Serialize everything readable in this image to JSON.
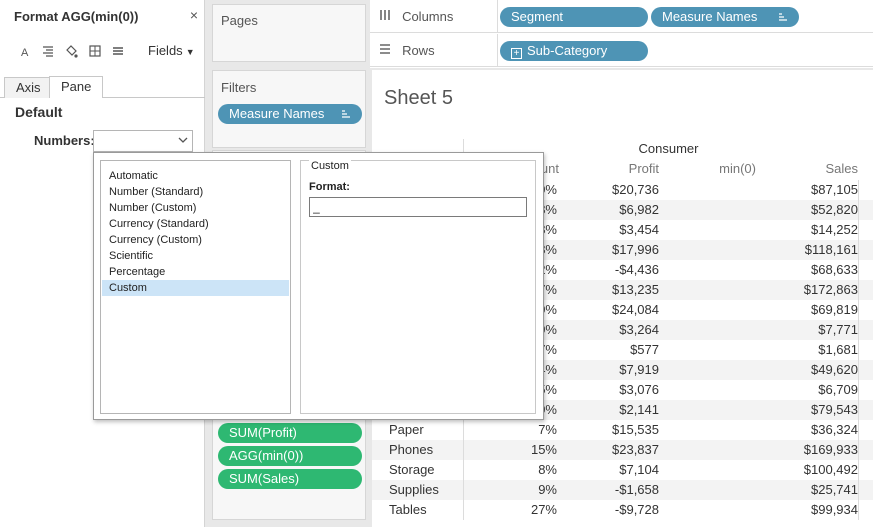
{
  "format_pane": {
    "title": "Format AGG(min(0))",
    "close": "×",
    "fields_label": "Fields",
    "tabs": [
      "Axis",
      "Pane"
    ],
    "active_tab": "Pane",
    "section": "Default",
    "numbers_label": "Numbers:",
    "numbers_value": "",
    "icons": [
      "font-icon",
      "alignment-icon",
      "shading-icon",
      "borders-icon",
      "lines-icon"
    ]
  },
  "cards": {
    "pages": "Pages",
    "filters": "Filters",
    "filter_pills": [
      "Measure Names"
    ],
    "marks_pills": [
      "SUM(Profit)",
      "AGG(min(0))",
      "SUM(Sales)"
    ]
  },
  "shelves": {
    "columns_label": "Columns",
    "rows_label": "Rows",
    "columns_pills": [
      "Segment",
      "Measure Names"
    ],
    "rows_pills": [
      "Sub-Category"
    ]
  },
  "view": {
    "sheet_title": "Sheet 5",
    "segment_header": "Consumer",
    "column_headers": [
      "unt",
      "Profit",
      "min(0)",
      "Sales"
    ],
    "rows": [
      {
        "subcat": "",
        "count": "9%",
        "profit": "$20,736",
        "sales": "$87,105"
      },
      {
        "subcat": "",
        "count": "8%",
        "profit": "$6,982",
        "sales": "$52,820"
      },
      {
        "subcat": "",
        "count": "8%",
        "profit": "$3,454",
        "sales": "$14,252"
      },
      {
        "subcat": "",
        "count": "8%",
        "profit": "$17,996",
        "sales": "$118,161"
      },
      {
        "subcat": "",
        "count": "2%",
        "profit": "-$4,436",
        "sales": "$68,633"
      },
      {
        "subcat": "",
        "count": "7%",
        "profit": "$13,235",
        "sales": "$172,863"
      },
      {
        "subcat": "",
        "count": "9%",
        "profit": "$24,084",
        "sales": "$69,819"
      },
      {
        "subcat": "",
        "count": "9%",
        "profit": "$3,264",
        "sales": "$7,771"
      },
      {
        "subcat": "",
        "count": "7%",
        "profit": "$577",
        "sales": "$1,681"
      },
      {
        "subcat": "",
        "count": "4%",
        "profit": "$7,919",
        "sales": "$49,620"
      },
      {
        "subcat": "",
        "count": "5%",
        "profit": "$3,076",
        "sales": "$6,709"
      },
      {
        "subcat": "",
        "count": "9%",
        "profit": "$2,141",
        "sales": "$79,543"
      },
      {
        "subcat": "Paper",
        "count": "7%",
        "profit": "$15,535",
        "sales": "$36,324"
      },
      {
        "subcat": "Phones",
        "count": "15%",
        "profit": "$23,837",
        "sales": "$169,933"
      },
      {
        "subcat": "Storage",
        "count": "8%",
        "profit": "$7,104",
        "sales": "$100,492"
      },
      {
        "subcat": "Supplies",
        "count": "9%",
        "profit": "-$1,658",
        "sales": "$25,741"
      },
      {
        "subcat": "Tables",
        "count": "27%",
        "profit": "-$9,728",
        "sales": "$99,934"
      }
    ]
  },
  "popup": {
    "options": [
      "Automatic",
      "Number (Standard)",
      "Number (Custom)",
      "Currency (Standard)",
      "Currency (Custom)",
      "Scientific",
      "Percentage",
      "Custom"
    ],
    "selected": "Custom",
    "group_label": "Custom",
    "format_label": "Format:",
    "format_value": "_"
  },
  "colors": {
    "dimension_pill": "#4e94b5",
    "measure_pill": "#2eb872",
    "selection": "#cce4f7"
  }
}
